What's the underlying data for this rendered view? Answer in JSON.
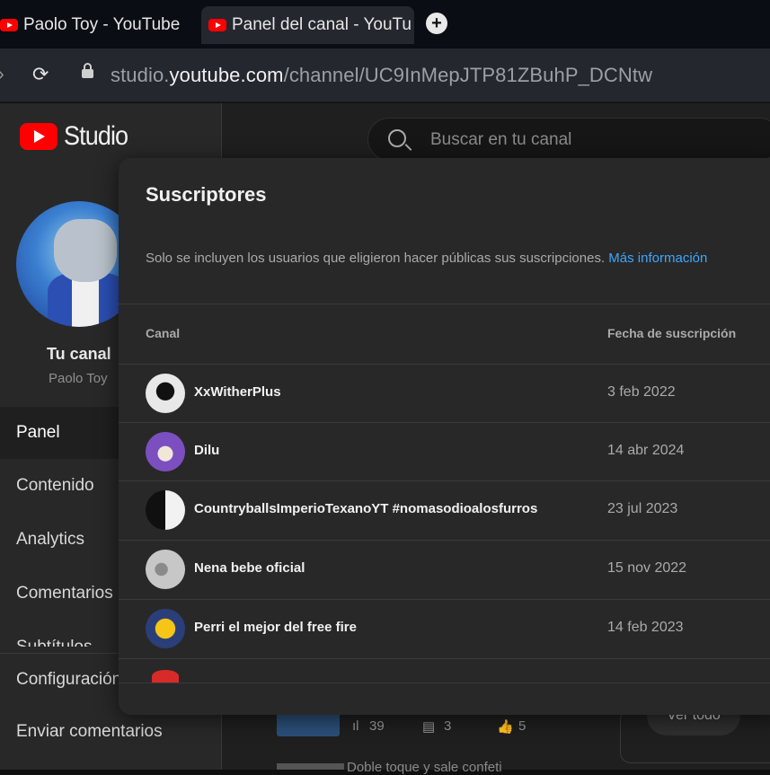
{
  "browser": {
    "tabs": [
      {
        "label": "Paolo Toy - YouTube",
        "active": false
      },
      {
        "label": "Panel del canal - YouTu",
        "active": true
      }
    ],
    "newtab_label": "+",
    "url_domain_prefix": "studio.",
    "url_domain": "youtube.com",
    "url_path": "/channel/UC9InMepJTP81ZBuhP_DCNtw"
  },
  "studio": {
    "logo_text": "Studio",
    "search_placeholder": "Buscar en tu canal",
    "channel": {
      "title": "Tu canal",
      "name": "Paolo Toy"
    },
    "nav": [
      "Panel",
      "Contenido",
      "Analytics",
      "Comentarios",
      "Subtítulos",
      "Configuración",
      "Enviar comentarios"
    ],
    "background": {
      "stats": [
        "39",
        "3",
        "5"
      ],
      "ver_todo": "Ver todo",
      "video_title_partial": "Doble toque y sale confeti"
    }
  },
  "modal": {
    "title": "Suscriptores",
    "description": "Solo se incluyen los usuarios que eligieron hacer públicas sus suscripciones.",
    "more_info": "Más información",
    "columns": {
      "channel": "Canal",
      "date": "Fecha de suscripción"
    },
    "subscribers": [
      {
        "name": "XxWitherPlus",
        "date": "3 feb 2022",
        "avatar_color": "#e8e8e8"
      },
      {
        "name": "Dilu",
        "date": "14 abr 2024",
        "avatar_color": "#7b4fc0"
      },
      {
        "name": "CountryballsImperioTexanoYT #nomasodioalosfurros",
        "date": "23 jul 2023",
        "avatar_color": "#101010"
      },
      {
        "name": "Nena bebe oficial",
        "date": "15 nov 2022",
        "avatar_color": "#c7c7c7"
      },
      {
        "name": "Perri el mejor del free fire",
        "date": "14 feb 2023",
        "avatar_color": "#2a3f7a"
      }
    ]
  },
  "colors": {
    "accent_link": "#3ea6ff",
    "brand_red": "#ff0000"
  }
}
